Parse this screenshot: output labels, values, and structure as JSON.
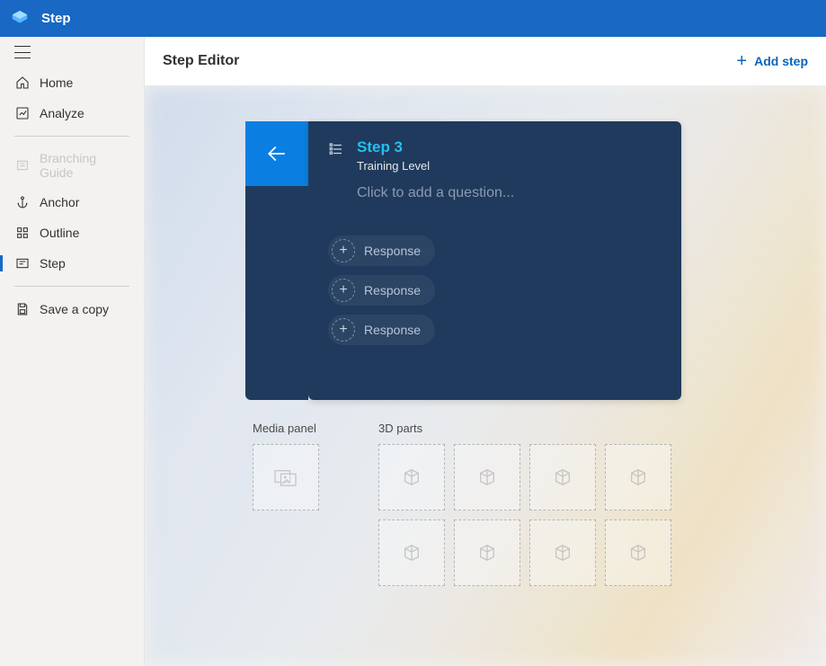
{
  "topbar": {
    "title": "Step"
  },
  "sidebar": {
    "items": [
      {
        "label": "Home"
      },
      {
        "label": "Analyze"
      },
      {
        "label": "Branching Guide"
      },
      {
        "label": "Anchor"
      },
      {
        "label": "Outline"
      },
      {
        "label": "Step"
      },
      {
        "label": "Save a copy"
      }
    ]
  },
  "editor": {
    "heading": "Step Editor",
    "add_step_label": "Add step"
  },
  "card": {
    "title": "Step 3",
    "subtitle": "Training Level",
    "question_placeholder": "Click to add a question...",
    "responses": [
      {
        "label": "Response"
      },
      {
        "label": "Response"
      },
      {
        "label": "Response"
      }
    ]
  },
  "panels": {
    "media_title": "Media panel",
    "parts_title": "3D parts"
  }
}
